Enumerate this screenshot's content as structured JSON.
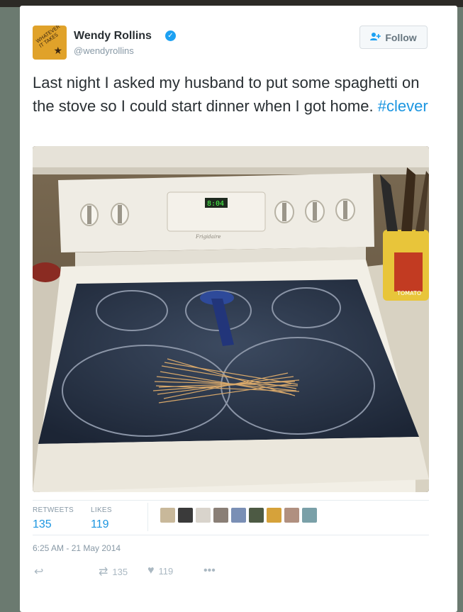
{
  "author": {
    "name": "Wendy Rollins",
    "handle": "@wendyrollins",
    "avatar_text": "WHATEVER IT TAKES"
  },
  "follow_button": {
    "label": "Follow",
    "icon": "add-user-icon"
  },
  "tweet": {
    "text": "Last night I asked my husband to put some spaghetti on the stove so I could start dinner when I got home.",
    "hashtag": "#clever"
  },
  "photo": {
    "stove_display": "8:04",
    "stove_brand": "Frigidaire",
    "canister_label": "TOMATO"
  },
  "stats": {
    "retweets_label": "RETWEETS",
    "retweets_value": "135",
    "likes_label": "LIKES",
    "likes_value": "119"
  },
  "likers": [
    "#c8b89a",
    "#3a3a3a",
    "#d9d4cc",
    "#8a7f76",
    "#7a8fb5",
    "#4d5a44",
    "#d6a23a",
    "#b09080",
    "#7aa0a8"
  ],
  "timestamp": "6:25 AM - 21 May 2014",
  "actions": {
    "reply_icon": "reply-icon",
    "retweet_icon": "retweet-icon",
    "retweet_count": "135",
    "like_icon": "heart-icon",
    "like_count": "119",
    "more_icon": "more-icon"
  },
  "colors": {
    "accent": "#1b95e0",
    "verified": "#1da1f2",
    "muted": "#8899a6"
  }
}
